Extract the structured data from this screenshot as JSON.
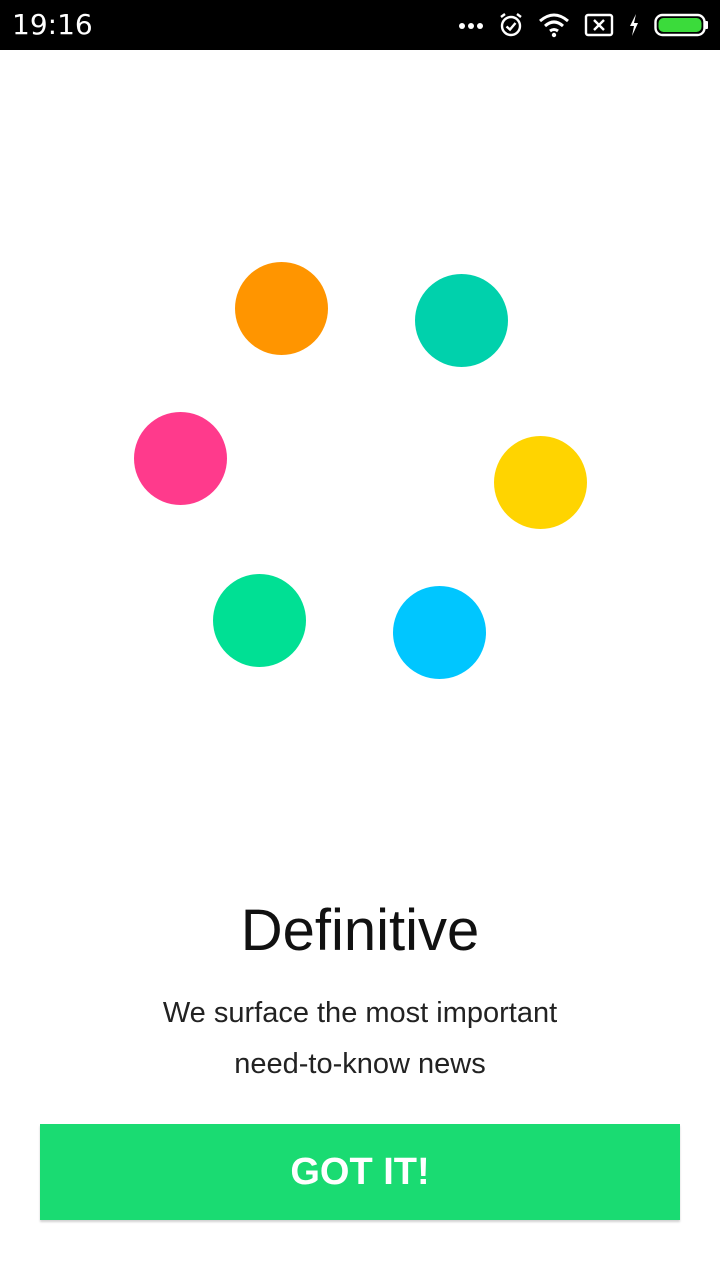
{
  "status_bar": {
    "time": "19:16",
    "icons": [
      "more-dots-icon",
      "alarm-icon",
      "wifi-icon",
      "sim-card-icon",
      "charging-icon",
      "battery-icon"
    ]
  },
  "illustration": {
    "dots": [
      {
        "name": "orange-dot",
        "color": "#FF9500"
      },
      {
        "name": "teal-dot",
        "color": "#00D1AC"
      },
      {
        "name": "pink-dot",
        "color": "#FF3A8C"
      },
      {
        "name": "yellow-dot",
        "color": "#FFD400"
      },
      {
        "name": "green-dot",
        "color": "#00E094"
      },
      {
        "name": "blue-dot",
        "color": "#00C6FF"
      }
    ]
  },
  "onboarding": {
    "title": "Definitive",
    "subtitle_line1": "We surface the most important",
    "subtitle_line2": "need-to-know news"
  },
  "actions": {
    "got_it_label": "GOT IT!"
  },
  "colors": {
    "accent": "#1ADB72",
    "status_bar_bg": "#000000",
    "battery": "#3BDB3B"
  }
}
